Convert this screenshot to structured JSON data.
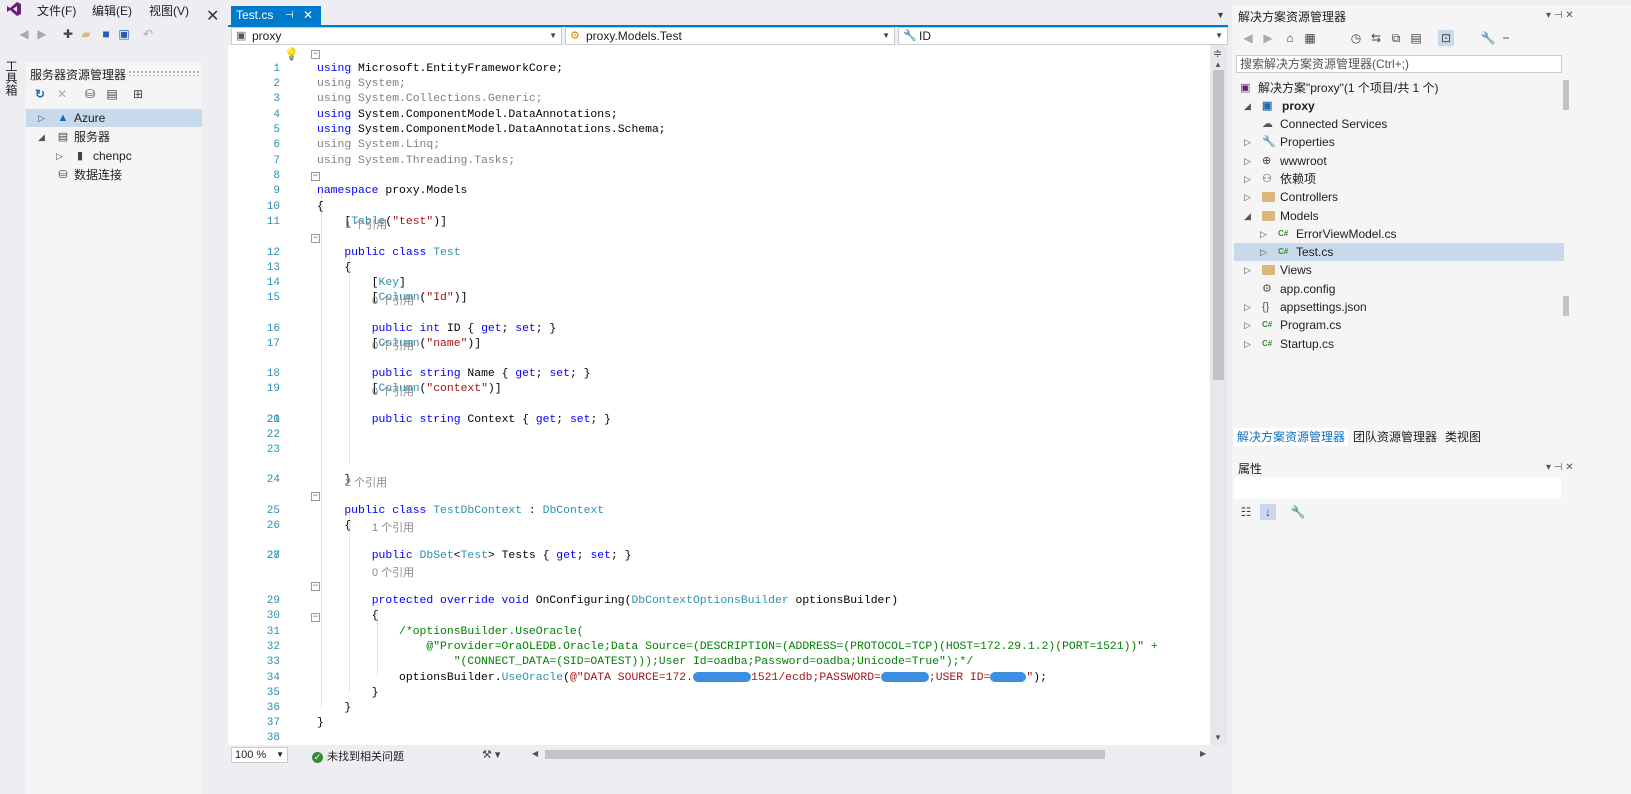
{
  "menu": {
    "items": [
      "文件(F)",
      "编辑(E)",
      "视图(V)"
    ]
  },
  "toolbox": {
    "label": "工具箱"
  },
  "server_explorer": {
    "title": "服务器资源管理器",
    "tree": [
      {
        "label": "Azure",
        "icon": "azure-icon",
        "level": 0,
        "selected": true
      },
      {
        "label": "服务器",
        "icon": "server-icon",
        "level": 0,
        "selected": false
      },
      {
        "label": "chenpc",
        "icon": "computer-icon",
        "level": 1,
        "selected": false
      },
      {
        "label": "数据连接",
        "icon": "data-connection-icon",
        "level": 0,
        "selected": false
      }
    ]
  },
  "editor": {
    "tab_label": "Test.cs",
    "nav": {
      "project": "proxy",
      "type": "proxy.Models.Test",
      "member": "ID"
    },
    "zoom": "100 %",
    "issues": "未找到相关问题",
    "references": {
      "r1": "1 个引用",
      "r0": "0 个引用",
      "r2": "2 个引用"
    }
  },
  "solution_explorer": {
    "title": "解决方案资源管理器",
    "search_placeholder": "搜索解决方案资源管理器(Ctrl+;)",
    "solution_label": "解决方案\"proxy\"(1 个项目/共 1 个)",
    "project_label": "proxy",
    "items": [
      {
        "label": "Connected Services",
        "icon": "connected-services-icon",
        "indent": 1,
        "expander": false
      },
      {
        "label": "Properties",
        "icon": "wrench-icon",
        "indent": 1,
        "expander": true
      },
      {
        "label": "wwwroot",
        "icon": "globe-icon",
        "indent": 1,
        "expander": true
      },
      {
        "label": "依赖项",
        "icon": "dependencies-icon",
        "indent": 1,
        "expander": true
      },
      {
        "label": "Controllers",
        "icon": "folder-icon",
        "indent": 1,
        "expander": true
      },
      {
        "label": "Models",
        "icon": "folder-icon",
        "indent": 1,
        "expander": "open"
      },
      {
        "label": "ErrorViewModel.cs",
        "icon": "csharp-file-icon",
        "indent": 2,
        "expander": true
      },
      {
        "label": "Test.cs",
        "icon": "csharp-file-icon",
        "indent": 2,
        "expander": true,
        "selected": true
      },
      {
        "label": "Views",
        "icon": "folder-icon",
        "indent": 1,
        "expander": true
      },
      {
        "label": "app.config",
        "icon": "config-file-icon",
        "indent": 1,
        "expander": false
      },
      {
        "label": "appsettings.json",
        "icon": "json-file-icon",
        "indent": 1,
        "expander": true
      },
      {
        "label": "Program.cs",
        "icon": "csharp-file-icon",
        "indent": 1,
        "expander": true
      },
      {
        "label": "Startup.cs",
        "icon": "csharp-file-icon",
        "indent": 1,
        "expander": true
      }
    ],
    "bottom_tabs": [
      "解决方案资源管理器",
      "团队资源管理器",
      "类视图"
    ]
  },
  "properties": {
    "title": "属性"
  },
  "colors": {
    "accent": "#007acc",
    "keyword": "#0000ff",
    "type": "#2b91af",
    "string": "#a31515",
    "comment": "#008000"
  }
}
